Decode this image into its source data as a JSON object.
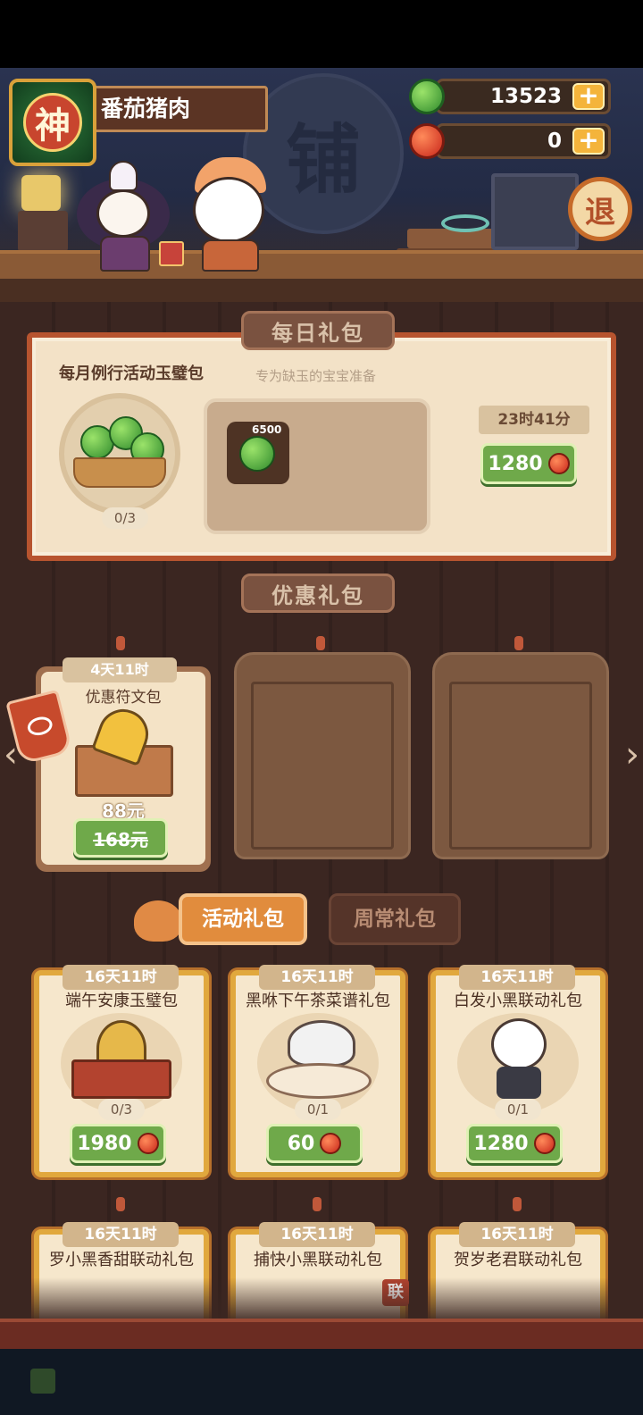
{
  "header": {
    "avatar_glyph": "神",
    "player_name": "番茄猪肉",
    "shop_sign": "铺",
    "jade_amount": "13523",
    "red_amount": "0",
    "plus_label": "+",
    "exit_label": "退"
  },
  "daily": {
    "section_title": "每日礼包",
    "pack_name": "每月例行活动玉璧包",
    "subtitle": "专为缺玉的宝宝准备",
    "progress": "0/3",
    "item_qty": "6500",
    "timer": "23时41分",
    "price": "1280"
  },
  "discount": {
    "section_title": "优惠礼包",
    "card": {
      "timer": "4天11时",
      "title": "优惠符文包",
      "sale_price": "88元",
      "original_price": "168元"
    }
  },
  "tabs": {
    "activity": "活动礼包",
    "regular": "周常礼包"
  },
  "activity_packs": [
    {
      "timer": "16天11时",
      "title": "端午安康玉璧包",
      "progress": "0/3",
      "price": "1980"
    },
    {
      "timer": "16天11时",
      "title": "黑咻下午茶菜谱礼包",
      "progress": "0/1",
      "price": "60"
    },
    {
      "timer": "16天11时",
      "title": "白发小黑联动礼包",
      "progress": "0/1",
      "price": "1280"
    },
    {
      "timer": "16天11时",
      "title": "罗小黑香甜联动礼包"
    },
    {
      "timer": "16天11时",
      "title": "捕快小黑联动礼包",
      "badge": "联"
    },
    {
      "timer": "16天11时",
      "title": "贺岁老君联动礼包"
    }
  ],
  "colors": {
    "wood_dark": "#3b2621",
    "panel_border": "#b7542f",
    "price_green": "#6fa94a",
    "gold_frame": "#e1a83d",
    "tab_active": "#e18c3d"
  }
}
